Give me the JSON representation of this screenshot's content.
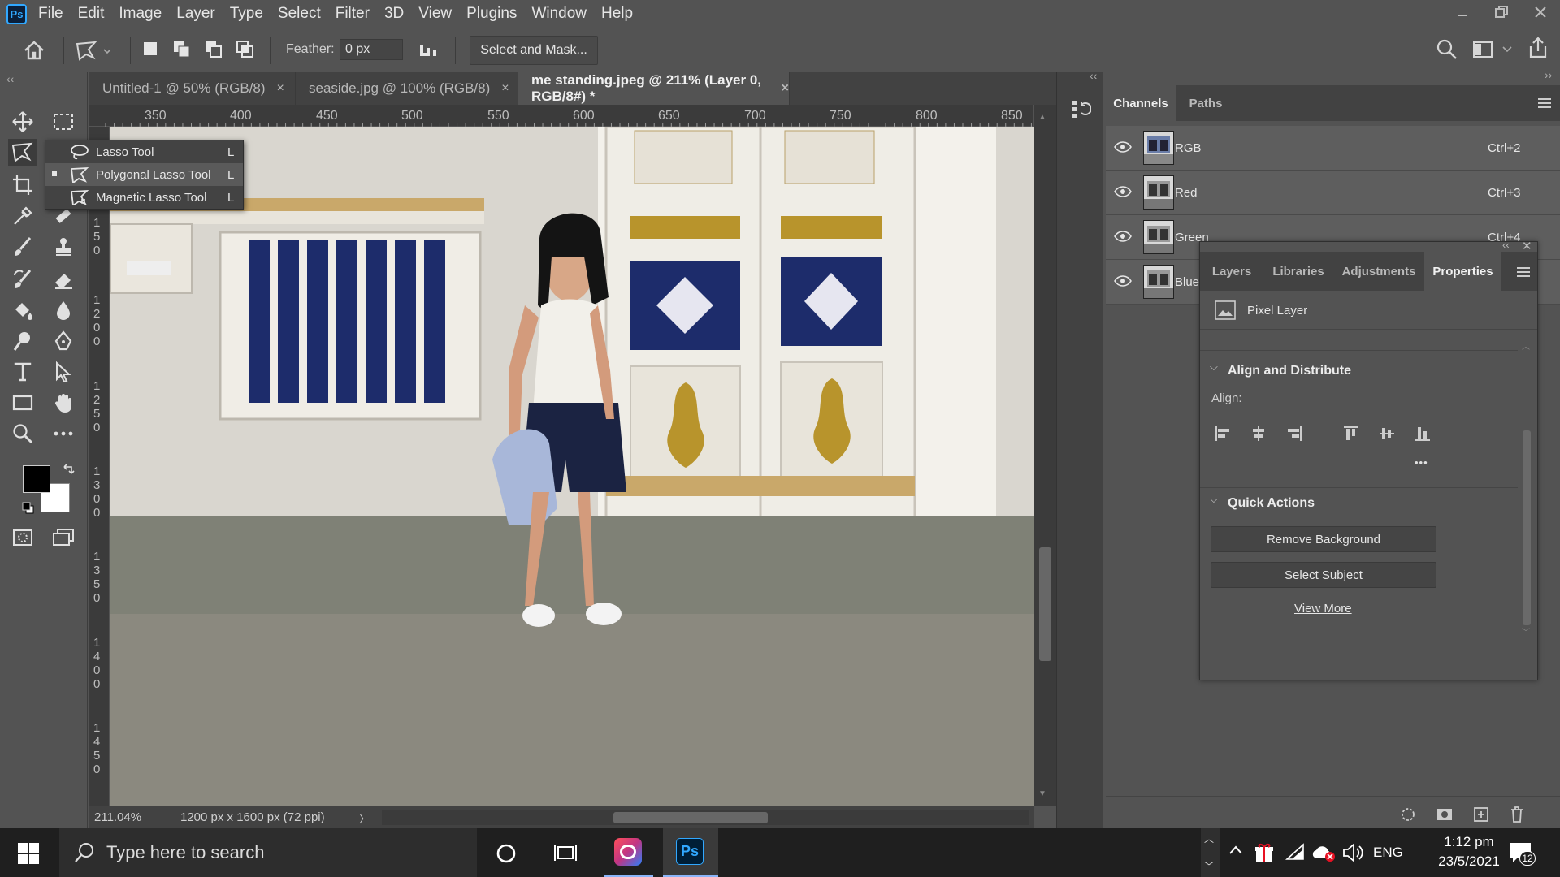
{
  "app": {
    "logo_text": "Ps"
  },
  "menu": [
    "File",
    "Edit",
    "Image",
    "Layer",
    "Type",
    "Select",
    "Filter",
    "3D",
    "View",
    "Plugins",
    "Window",
    "Help"
  ],
  "options_bar": {
    "feather_label": "Feather:",
    "feather_value": "0 px",
    "select_mask_label": "Select and Mask..."
  },
  "tabs": [
    {
      "label": "Untitled-1 @ 50% (RGB/8)",
      "close": "×"
    },
    {
      "label": "seaside.jpg @ 100% (RGB/8)",
      "close": "×"
    },
    {
      "label": "me standing.jpeg @ 211% (Layer 0, RGB/8#) *",
      "close": "×",
      "active": true
    }
  ],
  "flyout": [
    {
      "label": "Lasso Tool",
      "key": "L",
      "icon": "lasso-icon"
    },
    {
      "label": "Polygonal Lasso Tool",
      "key": "L",
      "icon": "polygonal-lasso-icon",
      "selected": true
    },
    {
      "label": "Magnetic Lasso Tool",
      "key": "L",
      "icon": "magnetic-lasso-icon"
    }
  ],
  "ruler_top": [
    "350",
    "400",
    "450",
    "500",
    "550",
    "600",
    "650",
    "700",
    "750",
    "800",
    "850"
  ],
  "ruler_left": [
    [
      "1",
      "5",
      "0"
    ],
    [
      "1",
      "2",
      "0",
      "0"
    ],
    [
      "1",
      "2",
      "5",
      "0"
    ],
    [
      "1",
      "3",
      "0",
      "0"
    ],
    [
      "1",
      "3",
      "5",
      "0"
    ],
    [
      "1",
      "4",
      "0",
      "0"
    ],
    [
      "1",
      "4",
      "5",
      "0"
    ]
  ],
  "status": {
    "zoom": "211.04%",
    "doc": "1200 px x 1600 px (72 ppi)",
    "arrow": "〉"
  },
  "channels_panel": {
    "tabs": [
      "Channels",
      "Paths"
    ],
    "rows": [
      {
        "name": "RGB",
        "shortcut": "Ctrl+2"
      },
      {
        "name": "Red",
        "shortcut": "Ctrl+3"
      },
      {
        "name": "Green",
        "shortcut": "Ctrl+4"
      },
      {
        "name": "Blue",
        "shortcut": ""
      }
    ]
  },
  "properties_panel": {
    "tabs": [
      "Layers",
      "Libraries",
      "Adjustments",
      "Properties"
    ],
    "layer_type": "Pixel Layer",
    "align_section": "Align and Distribute",
    "align_label": "Align:",
    "more": "•••",
    "quick_actions": "Quick Actions",
    "remove_bg": "Remove Background",
    "select_subject": "Select Subject",
    "view_more": "View More"
  },
  "taskbar": {
    "search_placeholder": "Type here to search",
    "language": "ENG",
    "time": "1:12 pm",
    "date": "23/5/2021",
    "notif_count": "12"
  },
  "colors": {
    "ps_blue": "#31a8ff",
    "panel": "#535353",
    "dark": "#424242"
  }
}
